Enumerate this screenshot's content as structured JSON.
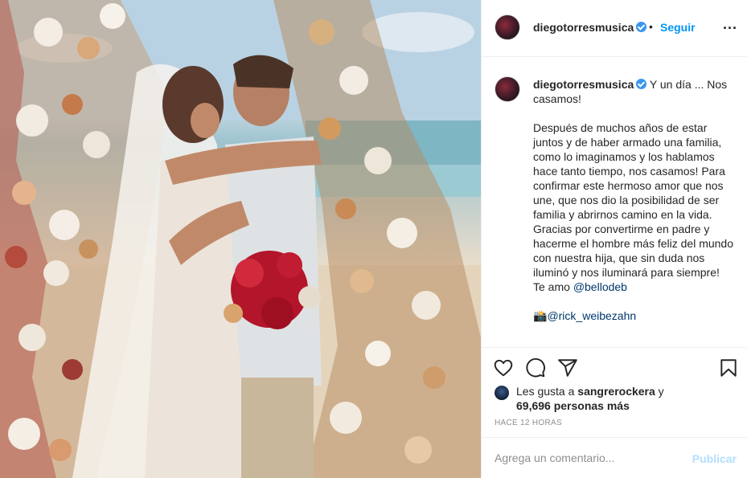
{
  "post": {
    "username": "diegotorresmusica",
    "follow_label": "Seguir",
    "dot": "•",
    "more_label": "..."
  },
  "caption": {
    "username": "diegotorresmusica",
    "first_line": "Y un día ... Nos casamos!",
    "body": "Después de muchos años de estar juntos y de haber armado una familia, como lo imaginamos y los hablamos hace tanto tiempo, nos casamos! Para confirmar este hermoso amor que nos une, que nos dio la posibilidad de ser familia y abrirnos camino en la vida. Gracias por convertirme en padre y hacerme el hombre más feliz del mundo con nuestra hija, que sin duda nos iluminó y nos iluminará para siempre!",
    "love_prefix": "Te amo ",
    "love_mention": "@bellodeb",
    "photo_credit_emoji": "📸",
    "photo_credit": "@rick_weibezahn"
  },
  "actions": {
    "icons": [
      "heart-icon",
      "comment-icon",
      "share-icon",
      "bookmark-icon"
    ]
  },
  "likes": {
    "prefix": "Les gusta a ",
    "user": "sangrerockera",
    "connector": " y",
    "count": "69,696 personas más"
  },
  "timestamp": "HACE 12 HORAS",
  "comment": {
    "placeholder": "Agrega un comentario...",
    "publish_label": "Publicar"
  },
  "colors": {
    "link": "#0095f6",
    "verified": "#3897f0",
    "mention": "#00376b",
    "publish_disabled": "#b2dffc",
    "muted": "#8e8e8e"
  }
}
